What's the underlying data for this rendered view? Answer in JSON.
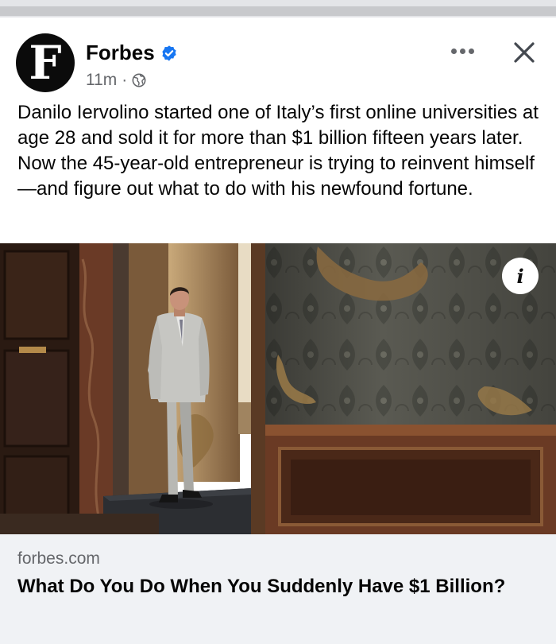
{
  "post": {
    "page_name": "Forbes",
    "avatar_letter": "F",
    "time": "11m",
    "separator": "·",
    "caption": "Danilo Iervolino started one of Italy’s first online universities at age 28 and sold it for more than $1 billion fifteen years later. Now the 45-year-old entrepreneur is trying to reinvent himself—and figure out what to do with his newfound fortune.",
    "info_icon": "i"
  },
  "link": {
    "domain": "forbes.com",
    "title": "What Do You Do When You Suddenly Have $1 Billion?"
  },
  "colors": {
    "verified_blue": "#1877f2",
    "meta_gray": "#65676b",
    "card_bg": "#f0f2f5"
  }
}
